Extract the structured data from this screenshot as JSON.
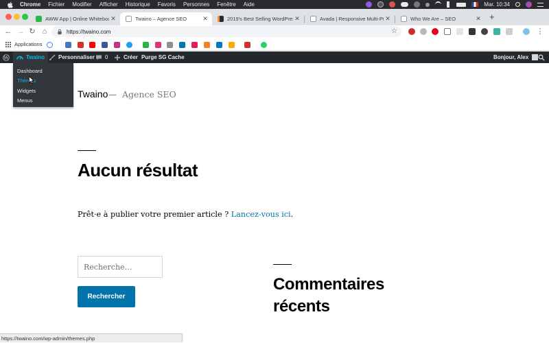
{
  "macos_menubar": {
    "app": "Chrome",
    "menus": [
      "Fichier",
      "Modifier",
      "Afficher",
      "Historique",
      "Favoris",
      "Personnes",
      "Fenêtre",
      "Aide"
    ],
    "clock": "Mar. 10:34"
  },
  "tabs": [
    {
      "label": "AWW App | Online Whiteboard",
      "favicon": "aww-icon",
      "color": "#2eb84b",
      "active": false
    },
    {
      "label": "Twaino – Agence SEO",
      "favicon": "page-icon",
      "color": "#ffffff",
      "active": true
    },
    {
      "label": "2019's Best Selling WordPress",
      "favicon": "themeforest-icon",
      "color": "#2b2b2b",
      "active": false
    },
    {
      "label": "Avada | Responsive Multi-Purp",
      "favicon": "page-icon",
      "color": "#ffffff",
      "active": false
    },
    {
      "label": "Who We Are – SEO",
      "favicon": "page-icon",
      "color": "#ffffff",
      "active": false
    }
  ],
  "toolbar": {
    "url": "https://twaino.com"
  },
  "bookmarks": {
    "apps_label": "Applications"
  },
  "wp_admin_bar": {
    "site_name": "Twaino",
    "customize": "Personnaliser",
    "comments_count": "0",
    "new": "Créer",
    "purge": "Purge SG Cache",
    "greeting": "Bonjour, Alex"
  },
  "site_menu": {
    "items": [
      "Dashboard",
      "Thèmes",
      "Widgets",
      "Menus"
    ],
    "hovered": "Thèmes"
  },
  "page": {
    "site_title": "Twaino",
    "separator": "—",
    "site_description": "Agence SEO",
    "heading": "Aucun résultat",
    "message": "Prêt·e à publier votre premier article ?",
    "message_link": "Lancez-vous ici",
    "message_end": ".",
    "search_placeholder": "Recherche…",
    "search_button": "Rechercher",
    "widget_title": "Commentaires récents"
  },
  "status_url": "https://twaino.com/wp-admin/themes.php",
  "colors": {
    "wp_admin_bar": "#23282d",
    "accent_link": "#0073aa",
    "admin_hover": "#00b9eb"
  }
}
